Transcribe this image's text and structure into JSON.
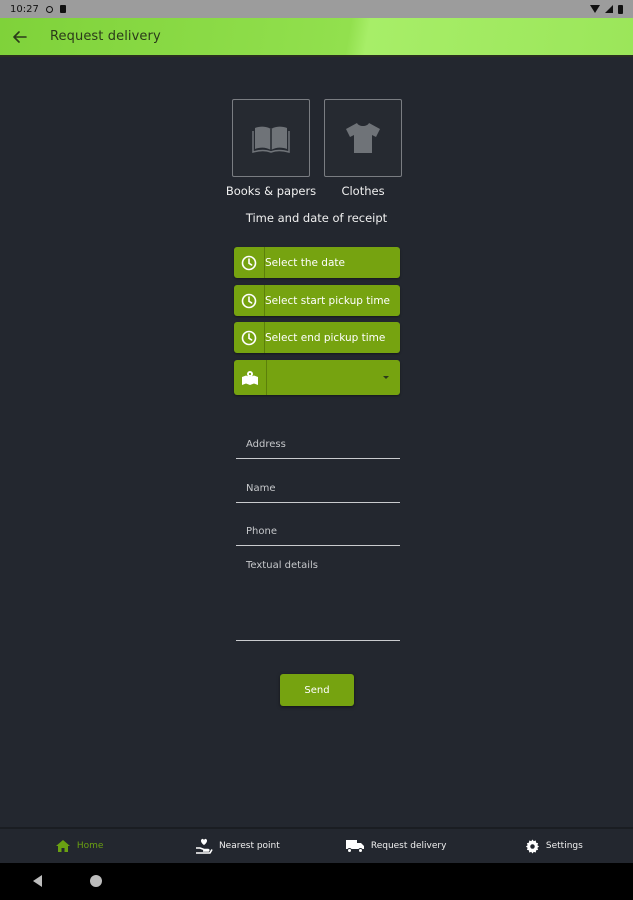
{
  "status_bar": {
    "time": "10:27"
  },
  "app_bar": {
    "title": "Request delivery",
    "back_icon": "arrow-left-icon"
  },
  "categories": [
    {
      "label": "Books & papers",
      "icon": "book-icon"
    },
    {
      "label": "Clothes",
      "icon": "tshirt-icon"
    }
  ],
  "receipt": {
    "title": "Time and date of receipt",
    "select_date": "Select the date",
    "select_start": "Select start pickup time",
    "select_end": "Select end pickup time",
    "location_dropdown_value": ""
  },
  "form": {
    "address_placeholder": "Address",
    "name_placeholder": "Name",
    "phone_placeholder": "Phone",
    "details_placeholder": "Textual details",
    "send_label": "Send"
  },
  "bottom_nav": [
    {
      "label": "Home",
      "icon": "home-icon",
      "active": true
    },
    {
      "label": "Nearest point",
      "icon": "hand-heart-icon",
      "active": false
    },
    {
      "label": "Request delivery",
      "icon": "truck-icon",
      "active": false
    },
    {
      "label": "Settings",
      "icon": "gear-icon",
      "active": false
    }
  ],
  "colors": {
    "accent": "#76a310",
    "app_bar": "#92e04e",
    "background": "#23272f",
    "active_nav": "#6aa012"
  }
}
